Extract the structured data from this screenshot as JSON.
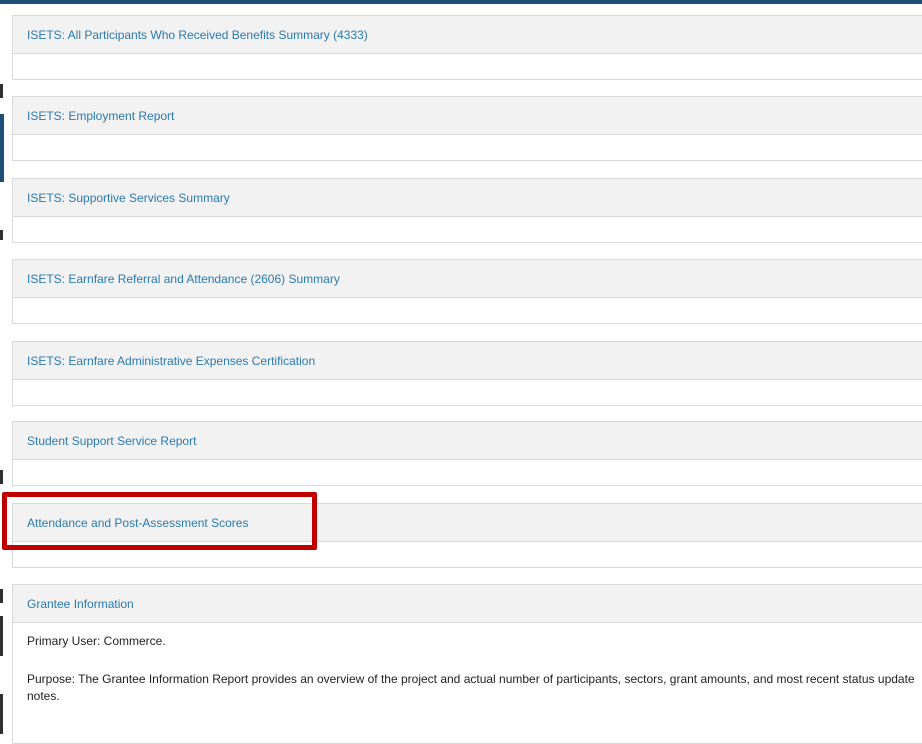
{
  "reports": [
    {
      "title": "ISETS: All Participants Who Received Benefits Summary (4333)"
    },
    {
      "title": "ISETS: Employment Report"
    },
    {
      "title": "ISETS: Supportive Services Summary"
    },
    {
      "title": "ISETS: Earnfare Referral and Attendance (2606) Summary"
    },
    {
      "title": "ISETS: Earnfare Administrative Expenses Certification"
    },
    {
      "title": "Student Support Service Report"
    },
    {
      "title": "Attendance and Post-Assessment Scores"
    }
  ],
  "grantee": {
    "title": "Grantee Information",
    "primary_user": "Primary User: Commerce.",
    "purpose": "Purpose: The Grantee Information Report provides an overview of the project and actual number of participants, sectors, grant amounts, and most recent status update notes."
  },
  "colors": {
    "link": "#2a7ab0",
    "highlight": "#c00000",
    "header_bg": "#f2f2f2"
  }
}
